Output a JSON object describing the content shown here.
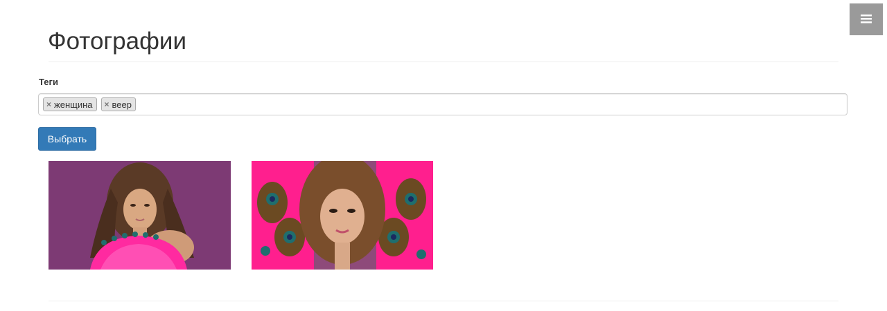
{
  "header": {
    "title": "Фотографии",
    "menu_icon": "hamburger-icon"
  },
  "tags": {
    "label": "Теги",
    "items": [
      {
        "label": "женщина",
        "remove_icon": "close-icon"
      },
      {
        "label": "веер",
        "remove_icon": "close-icon"
      }
    ]
  },
  "actions": {
    "select_label": "Выбрать"
  },
  "colors": {
    "primary_button": "#337ab7",
    "menu_button": "#9a9a9a",
    "photo_bg_purple": "#7d3a74",
    "photo_bg_pink": "#ff1f8e"
  },
  "photos": [
    {
      "subject": "woman with pink feather fan on purple background"
    },
    {
      "subject": "woman with peacock feathers on pink background"
    }
  ]
}
